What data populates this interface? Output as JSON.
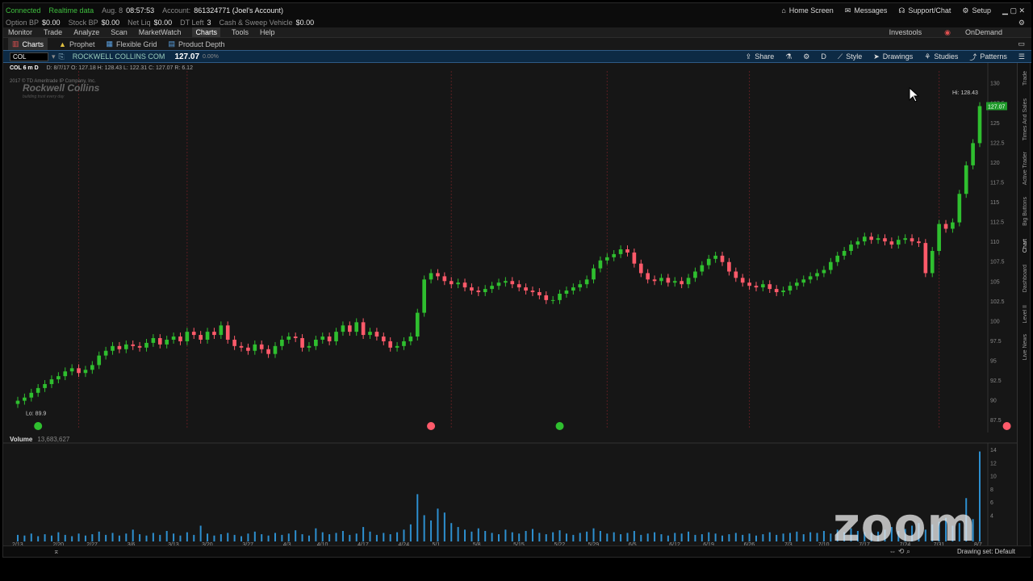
{
  "status_bar": {
    "connected": "Connected",
    "realtime": "Realtime data",
    "date": "Aug. 8",
    "time": "08:57:53",
    "account_label": "Account:",
    "account": "861324771 (Joel's Account)",
    "home_screen": "Home Screen",
    "messages": "Messages",
    "support": "Support/Chat",
    "setup": "Setup"
  },
  "balances": {
    "option_bp_label": "Option BP",
    "option_bp": "$0.00",
    "stock_bp_label": "Stock BP",
    "stock_bp": "$0.00",
    "net_liq_label": "Net Liq",
    "net_liq": "$0.00",
    "dt_left_label": "DT Left",
    "dt_left": "3",
    "cash_label": "Cash & Sweep Vehicle",
    "cash": "$0.00"
  },
  "menu": {
    "items": [
      "Monitor",
      "Trade",
      "Analyze",
      "Scan",
      "MarketWatch",
      "Charts",
      "Tools",
      "Help"
    ],
    "right_items": [
      "Investools",
      "OnDemand"
    ]
  },
  "subtabs": [
    "Charts",
    "Prophet",
    "Flexible Grid",
    "Product Depth"
  ],
  "toolbar": {
    "symbol": "COL",
    "company": "ROCKWELL COLLINS COM",
    "price": "127.07",
    "change": "0.00%",
    "tools": [
      "Share",
      "Style",
      "Drawings",
      "Studies",
      "Patterns"
    ],
    "period_btn": "D"
  },
  "chart_info": {
    "title": "COL 6 m D",
    "ohlc": "D: 8/7/17  O: 127.18  H: 128.43  L: 122.31  C: 127.07  R: 6.12",
    "copyright": "2017 © TD Ameritrade IP Company, Inc.",
    "logo_name": "Rockwell Collins",
    "logo_tagline": "building trust every day"
  },
  "volume_info": {
    "label": "Volume",
    "value": "13,683,627"
  },
  "sidebar_tabs": [
    "Trade",
    "Times And Sales",
    "Active Trader",
    "Big Buttons",
    "Chart",
    "Dashboard",
    "Level II",
    "Live News"
  ],
  "footer": {
    "drawing_set": "Drawing set: Default"
  },
  "watermark": "zoom",
  "colors": {
    "up": "#2fbf2f",
    "down": "#ff5a6a",
    "volume": "#2d8fcf",
    "last_price": "#1f9a2a",
    "toolbar_bg": "#0d2a44"
  },
  "chart_data": {
    "type": "candlestick",
    "y_ticks": [
      130,
      127.5,
      125,
      122.5,
      120,
      117.5,
      115,
      112.5,
      110,
      107.5,
      105,
      102.5,
      100,
      97.5,
      95,
      92.5,
      90,
      87.5
    ],
    "x_ticks": [
      "2/13",
      "2/20",
      "2/27",
      "3/6",
      "3/13",
      "3/20",
      "3/27",
      "4/3",
      "4/10",
      "4/17",
      "4/24",
      "5/1",
      "5/8",
      "5/15",
      "5/22",
      "5/29",
      "6/5",
      "6/12",
      "6/19",
      "6/26",
      "7/3",
      "7/10",
      "7/17",
      "7/24",
      "7/31",
      "8/7"
    ],
    "ylim": [
      86.5,
      131.5
    ],
    "hi_label": "Hi: 128.43",
    "lo_label": "Lo: 89.9",
    "last_price": "127.07",
    "close": [
      89.9,
      90.3,
      90.9,
      91.5,
      92.0,
      92.6,
      93.0,
      93.6,
      94.0,
      93.4,
      93.8,
      94.4,
      95.6,
      96.2,
      96.8,
      96.4,
      97.0,
      96.8,
      96.6,
      97.2,
      97.8,
      97.0,
      97.6,
      98.0,
      97.4,
      98.6,
      98.2,
      97.6,
      98.6,
      98.2,
      99.4,
      97.6,
      96.8,
      96.6,
      96.2,
      97.0,
      96.4,
      95.8,
      96.8,
      97.6,
      98.0,
      97.8,
      96.6,
      96.8,
      97.6,
      98.0,
      97.4,
      98.6,
      99.4,
      98.6,
      99.8,
      98.2,
      98.6,
      98.0,
      97.4,
      96.6,
      96.8,
      97.4,
      98.0,
      101.0,
      105.2,
      106.0,
      105.6,
      105.0,
      104.6,
      104.8,
      104.2,
      103.8,
      103.6,
      104.0,
      104.4,
      104.8,
      105.0,
      104.6,
      104.2,
      103.8,
      103.6,
      103.2,
      102.6,
      102.6,
      103.4,
      103.8,
      104.2,
      104.6,
      105.2,
      106.6,
      107.6,
      108.0,
      108.4,
      109.0,
      108.6,
      107.2,
      106.0,
      105.2,
      105.0,
      105.4,
      104.8,
      105.0,
      104.6,
      105.4,
      106.2,
      107.0,
      107.8,
      108.2,
      107.4,
      106.2,
      105.4,
      104.8,
      104.4,
      104.2,
      104.6,
      104.0,
      103.6,
      103.8,
      104.4,
      104.8,
      105.2,
      105.6,
      106.0,
      106.4,
      107.4,
      108.2,
      108.8,
      109.6,
      110.0,
      110.6,
      110.2,
      110.4,
      110.0,
      109.6,
      110.2,
      110.4,
      110.0,
      109.8,
      106.0,
      108.8,
      112.2,
      111.6,
      112.4,
      116.0,
      119.6,
      122.4,
      127.07
    ],
    "volume_millions": [
      1.0,
      0.9,
      1.2,
      0.8,
      1.1,
      0.9,
      1.4,
      1.0,
      0.8,
      1.2,
      0.9,
      1.1,
      1.5,
      1.0,
      1.3,
      0.9,
      1.2,
      1.8,
      1.1,
      0.9,
      1.3,
      1.0,
      1.6,
      1.2,
      0.9,
      1.4,
      1.0,
      2.4,
      1.2,
      0.9,
      1.1,
      1.3,
      1.0,
      0.8,
      1.2,
      1.5,
      1.1,
      0.9,
      1.3,
      1.0,
      1.2,
      1.7,
      1.1,
      0.9,
      2.0,
      1.4,
      1.1,
      1.3,
      1.6,
      1.0,
      1.2,
      2.2,
      1.5,
      1.0,
      1.3,
      1.1,
      1.4,
      1.8,
      2.6,
      7.2,
      4.0,
      3.2,
      5.0,
      4.4,
      2.8,
      2.2,
      1.8,
      1.5,
      2.0,
      1.6,
      1.3,
      1.1,
      1.8,
      1.4,
      1.2,
      1.6,
      1.9,
      1.3,
      1.1,
      1.4,
      1.7,
      1.2,
      1.0,
      1.3,
      1.5,
      2.0,
      1.6,
      1.2,
      1.4,
      1.1,
      1.3,
      1.6,
      1.0,
      1.2,
      1.4,
      1.1,
      0.9,
      1.3,
      1.2,
      1.5,
      1.0,
      1.1,
      1.4,
      1.2,
      0.9,
      1.1,
      1.3,
      1.0,
      1.2,
      0.9,
      1.1,
      1.4,
      1.0,
      1.2,
      1.3,
      1.5,
      1.1,
      1.4,
      1.3,
      1.6,
      1.2,
      1.8,
      1.4,
      2.0,
      1.6,
      1.4,
      1.3,
      1.5,
      1.8,
      2.2,
      1.6,
      1.9,
      2.4,
      2.8,
      1.8,
      2.6,
      3.0,
      3.6,
      2.4,
      2.8,
      6.6,
      3.4,
      13.7
    ],
    "volume_ticks": [
      14,
      12,
      10,
      8,
      6,
      4
    ],
    "volume_unit": "millions"
  }
}
